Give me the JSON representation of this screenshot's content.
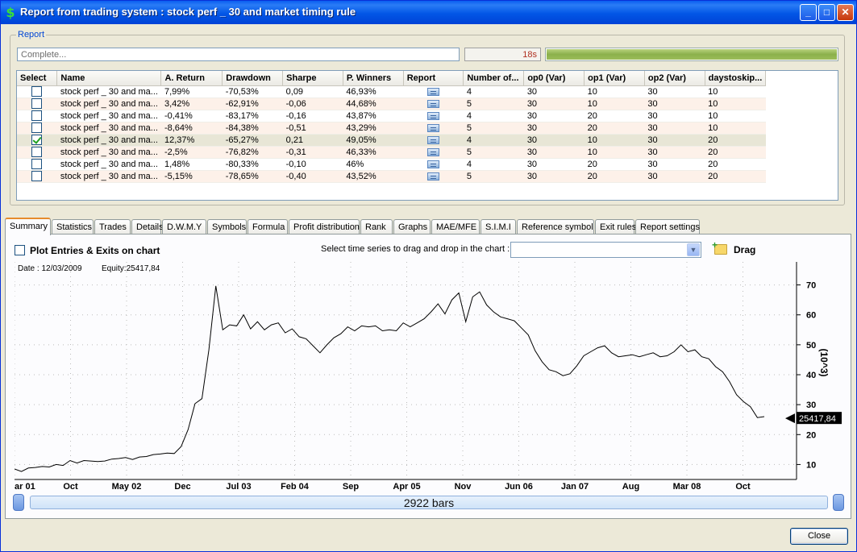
{
  "window": {
    "title": "Report from trading system : stock perf _ 30 and market timing rule",
    "app_icon": "dollar-icon"
  },
  "report": {
    "legend": "Report",
    "status": "Complete...",
    "elapsed": "18s",
    "progress": 1.0
  },
  "grid": {
    "columns": [
      "Select",
      "Name",
      "A. Return",
      "Drawdown",
      "Sharpe",
      "P. Winners",
      "Report",
      "Number of...",
      "op0 (Var)",
      "op1 (Var)",
      "op2 (Var)",
      "daystoskip..."
    ],
    "rows": [
      {
        "checked": false,
        "name": "stock perf _ 30 and ma...",
        "ret": "7,99%",
        "dd": "-70,53%",
        "sharpe": "0,09",
        "win": "46,93%",
        "n": "4",
        "op0": "30",
        "op1": "10",
        "op2": "30",
        "skip": "10"
      },
      {
        "checked": false,
        "name": "stock perf _ 30 and ma...",
        "ret": "3,42%",
        "dd": "-62,91%",
        "sharpe": "-0,06",
        "win": "44,68%",
        "n": "5",
        "op0": "30",
        "op1": "10",
        "op2": "30",
        "skip": "10"
      },
      {
        "checked": false,
        "name": "stock perf _ 30 and ma...",
        "ret": "-0,41%",
        "dd": "-83,17%",
        "sharpe": "-0,16",
        "win": "43,87%",
        "n": "4",
        "op0": "30",
        "op1": "20",
        "op2": "30",
        "skip": "10"
      },
      {
        "checked": false,
        "name": "stock perf _ 30 and ma...",
        "ret": "-8,64%",
        "dd": "-84,38%",
        "sharpe": "-0,51",
        "win": "43,29%",
        "n": "5",
        "op0": "30",
        "op1": "20",
        "op2": "30",
        "skip": "10"
      },
      {
        "checked": true,
        "name": "stock perf _ 30 and ma...",
        "ret": "12,37%",
        "dd": "-65,27%",
        "sharpe": "0,21",
        "win": "49,05%",
        "n": "4",
        "op0": "30",
        "op1": "10",
        "op2": "30",
        "skip": "20"
      },
      {
        "checked": false,
        "name": "stock perf _ 30 and ma...",
        "ret": "-2,5%",
        "dd": "-76,82%",
        "sharpe": "-0,31",
        "win": "46,33%",
        "n": "5",
        "op0": "30",
        "op1": "10",
        "op2": "30",
        "skip": "20"
      },
      {
        "checked": false,
        "name": "stock perf _ 30 and ma...",
        "ret": "1,48%",
        "dd": "-80,33%",
        "sharpe": "-0,10",
        "win": "46%",
        "n": "4",
        "op0": "30",
        "op1": "20",
        "op2": "30",
        "skip": "20"
      },
      {
        "checked": false,
        "name": "stock perf _ 30 and ma...",
        "ret": "-5,15%",
        "dd": "-78,65%",
        "sharpe": "-0,40",
        "win": "43,52%",
        "n": "5",
        "op0": "30",
        "op1": "20",
        "op2": "30",
        "skip": "20"
      }
    ]
  },
  "tabs": [
    "Summary",
    "Statistics",
    "Trades",
    "Details",
    "D.W.M.Y",
    "Symbols",
    "Formula",
    "Profit distribution",
    "Rank",
    "Graphs",
    "MAE/MFE",
    "S.I.M.I",
    "Reference symbol",
    "Exit rules",
    "Report settings"
  ],
  "active_tab": "Summary",
  "summary": {
    "plot_entries_label": "Plot Entries & Exits on chart",
    "plot_entries_checked": false,
    "series_label": "Select time series to drag and drop in the chart :",
    "series_value": "",
    "drag_label": "Drag",
    "drag_icon": "folder-add-icon"
  },
  "chart_data": {
    "type": "line",
    "info_date": "Date : 12/03/2009",
    "info_equity": "Equity:25417,84",
    "x_ticks": [
      "ar 01",
      "Oct",
      "May 02",
      "Dec",
      "Jul 03",
      "Feb 04",
      "Sep",
      "Apr 05",
      "Nov",
      "Jun 06",
      "Jan 07",
      "Aug",
      "Mar 08",
      "Oct"
    ],
    "y_ticks": [
      "70",
      "60",
      "50",
      "40",
      "30",
      "20",
      "10"
    ],
    "y_unit": "(10^3)",
    "ylim": [
      5,
      75
    ],
    "last_value_label": "25417,84",
    "series": [
      {
        "values": [
          8.5,
          8,
          8.5,
          9,
          9,
          9.5,
          10,
          10,
          11,
          10.5,
          11,
          11.5,
          11,
          11.5,
          11.5,
          12,
          12,
          12,
          12.5,
          13,
          13,
          13.5,
          13.5,
          14,
          16,
          22,
          30,
          32,
          48,
          70,
          55,
          57,
          56,
          60,
          55,
          58,
          55,
          57,
          57,
          54,
          55,
          53,
          52,
          50,
          47,
          50,
          52,
          54,
          56,
          55,
          56,
          56,
          56,
          55,
          55,
          55,
          57,
          56,
          57,
          59,
          61,
          64,
          60,
          65,
          67,
          58,
          66,
          68,
          63,
          61,
          59,
          59,
          58,
          56,
          53,
          48,
          44,
          42,
          41,
          40,
          40,
          43,
          46,
          48,
          49,
          50,
          47,
          46,
          46,
          47,
          46,
          47,
          47,
          46,
          46,
          48,
          50,
          48,
          48,
          46,
          45,
          43,
          41,
          38,
          33,
          31,
          29,
          26,
          26
        ],
        "last_value": 25.42
      }
    ]
  },
  "scrollbar": {
    "label": "2922 bars"
  },
  "footer": {
    "close_label": "Close"
  },
  "colors": {
    "titlebar": "#0256e6",
    "progress": "#8bb04b",
    "tab_accent": "#e68b2c",
    "row_alt": "#fdf1e9"
  }
}
